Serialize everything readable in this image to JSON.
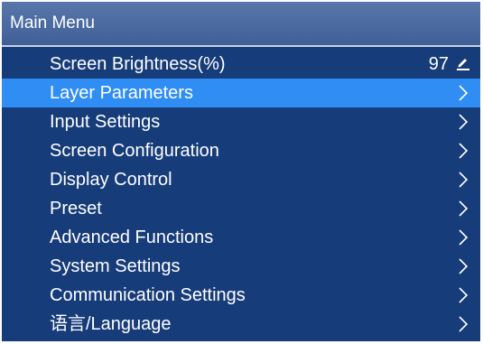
{
  "window": {
    "title": "Main Menu"
  },
  "menu": {
    "brightness": {
      "label": "Screen Brightness(%)",
      "value": "97",
      "icon": "edit-icon"
    },
    "items": [
      {
        "label": "Layer Parameters",
        "icon": "chevron-right-icon"
      },
      {
        "label": "Input Settings",
        "icon": "chevron-right-icon"
      },
      {
        "label": "Screen Configuration",
        "icon": "chevron-right-icon"
      },
      {
        "label": "Display Control",
        "icon": "chevron-right-icon"
      },
      {
        "label": "Preset",
        "icon": "chevron-right-icon"
      },
      {
        "label": "Advanced Functions",
        "icon": "chevron-right-icon"
      },
      {
        "label": "System Settings",
        "icon": "chevron-right-icon"
      },
      {
        "label": "Communication Settings",
        "icon": "chevron-right-icon"
      },
      {
        "label": "语言/Language",
        "icon": "chevron-right-icon"
      }
    ],
    "selected_label": "Layer Parameters"
  },
  "colors": {
    "background": "#173c7a",
    "title_bar": "#4a6aa0",
    "selected_row": "#2f8df4",
    "text": "#ffffff"
  }
}
